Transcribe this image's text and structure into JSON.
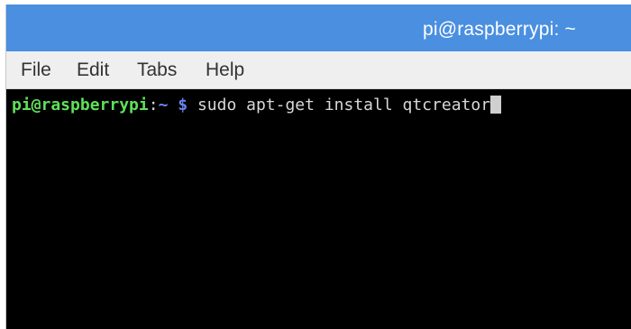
{
  "window": {
    "title": "pi@raspberrypi: ~"
  },
  "menubar": {
    "items": [
      {
        "label": "File"
      },
      {
        "label": "Edit"
      },
      {
        "label": "Tabs"
      },
      {
        "label": "Help"
      }
    ]
  },
  "terminal": {
    "prompt_user_host": "pi@raspberrypi",
    "prompt_separator": ":",
    "prompt_path": "~",
    "prompt_symbol": "$",
    "command": "sudo apt-get install qtcreator"
  },
  "colors": {
    "titlebar": "#4a8fe0",
    "menubar": "#efefef",
    "terminal_background": "#000000",
    "prompt_user": "#5fe05a",
    "prompt_path": "#6b84f0",
    "command_text": "#d8d8d8"
  }
}
